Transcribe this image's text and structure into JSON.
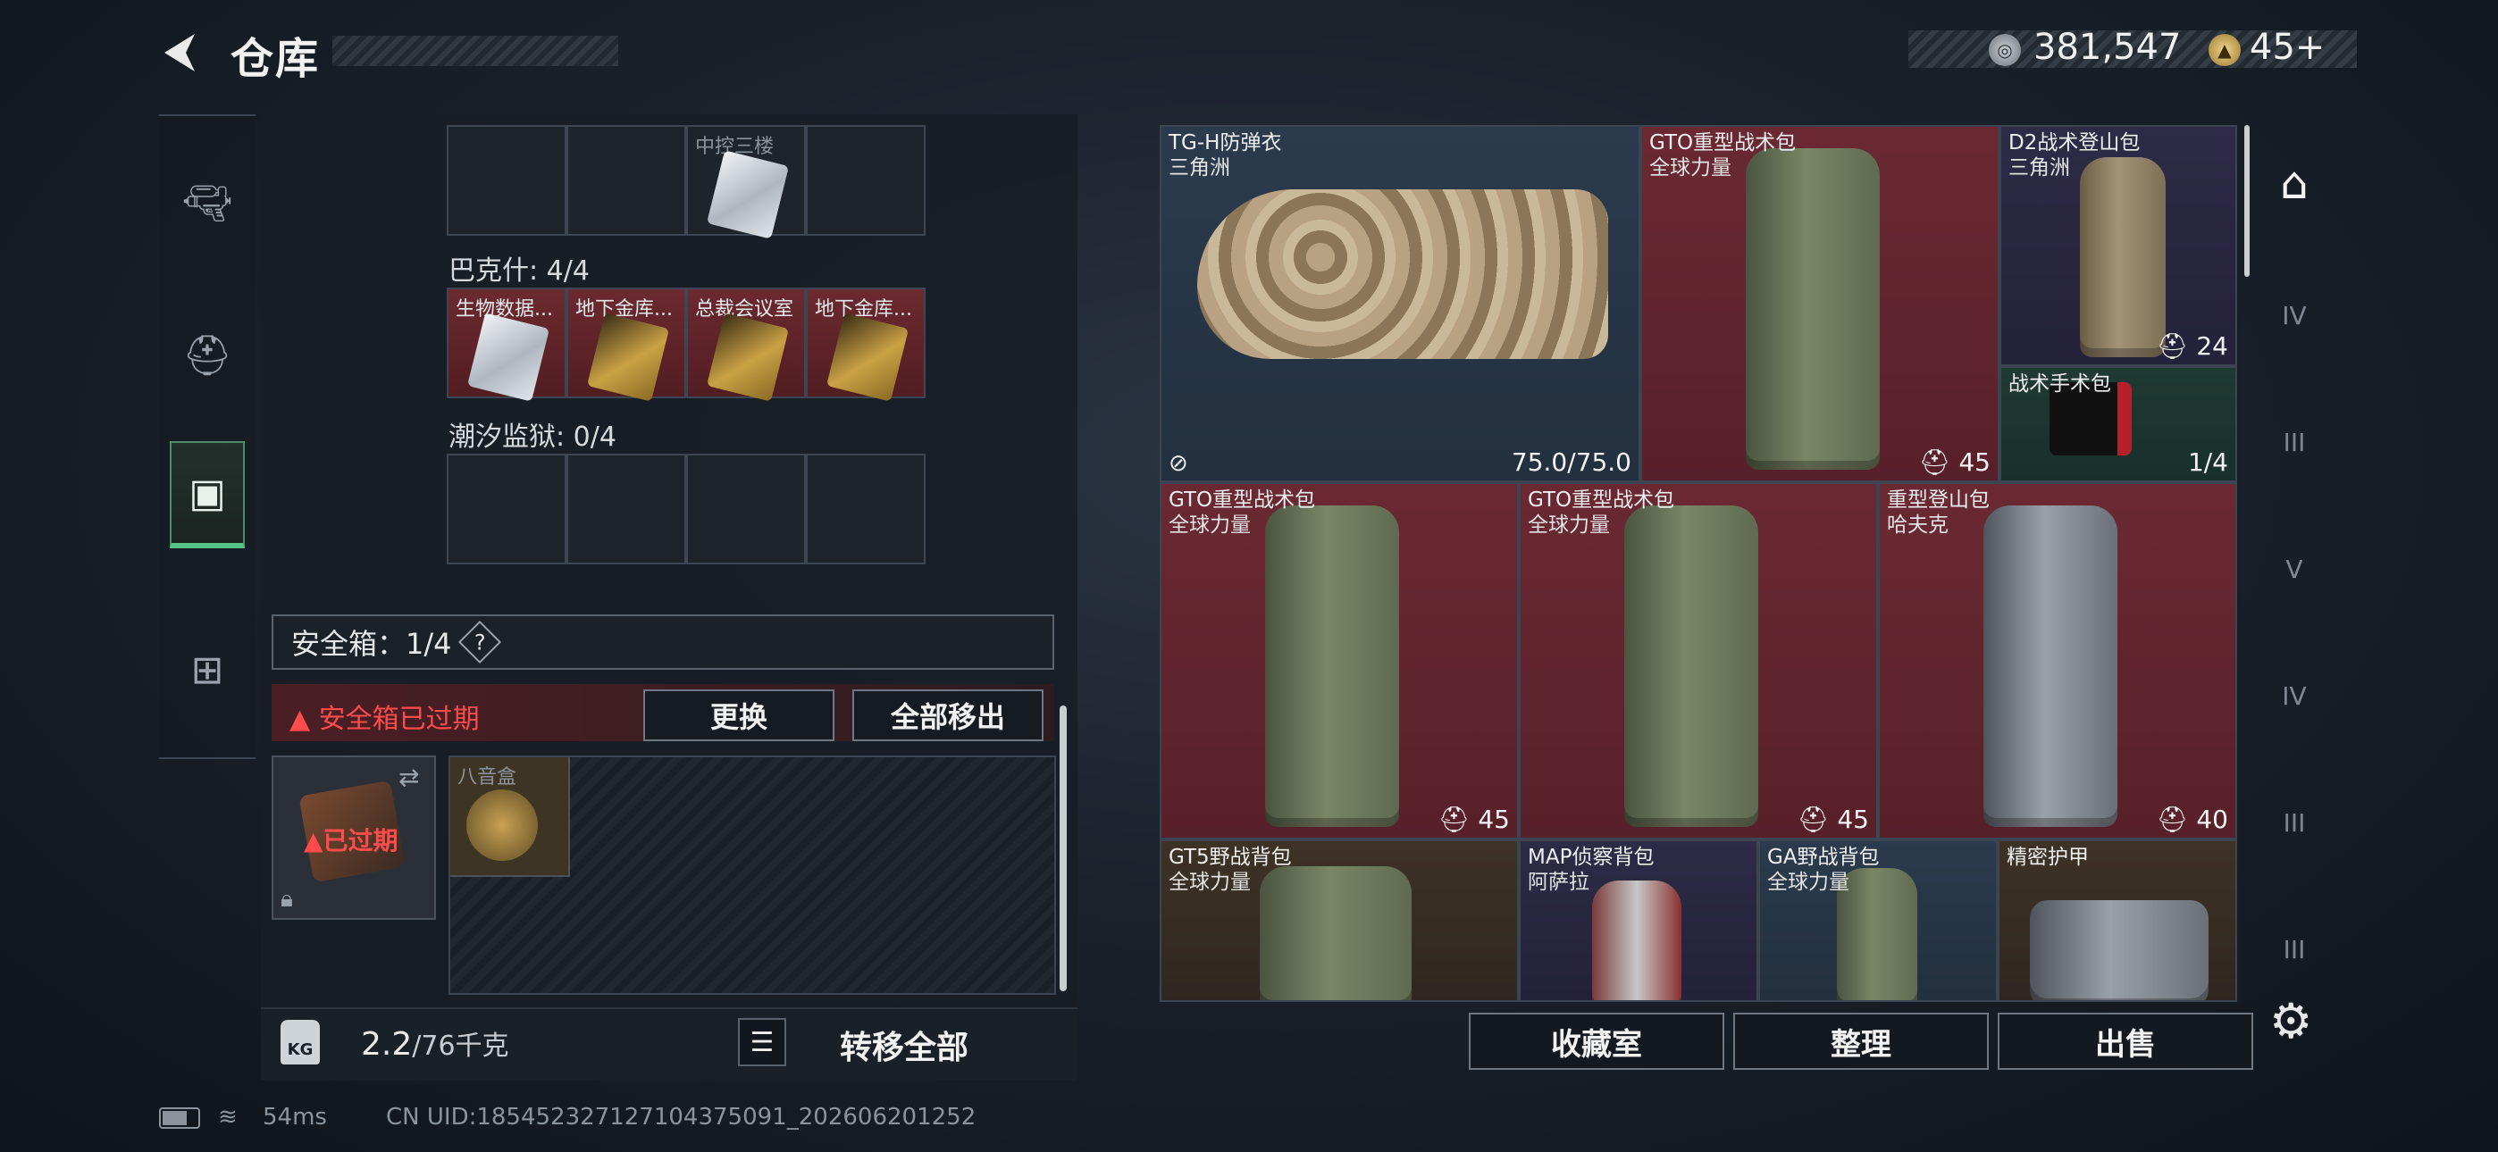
{
  "header": {
    "title": "仓库",
    "money": "381,547",
    "tokens": "45+"
  },
  "left": {
    "top_cell_label": "中控三楼",
    "sections": [
      {
        "label": "巴克什: 4/4",
        "cells": [
          "生物数据...",
          "地下金库...",
          "总裁会议室",
          "地下金库..."
        ]
      },
      {
        "label": "潮汐监狱: 0/4",
        "cells": [
          "",
          "",
          "",
          ""
        ]
      }
    ],
    "safebox_label": "安全箱：1/4",
    "safebox_help": "?",
    "expired_warning": "安全箱已过期",
    "btn_replace": "更换",
    "btn_move_all": "全部移出",
    "case_expired": "已过期",
    "container_item": "八音盒",
    "weight_value": "2.2",
    "weight_cap": "/76千克",
    "kg_label": "KG",
    "transfer_all": "转移全部"
  },
  "items": [
    {
      "name": "TG-H防弹衣",
      "sub": "三角洲",
      "count": "75.0/75.0",
      "bg": "blue"
    },
    {
      "name": "GTO重型战术包",
      "sub": "全球力量",
      "count": "45",
      "bg": "red"
    },
    {
      "name": "D2战术登山包",
      "sub": "三角洲",
      "count": "24",
      "bg": "purple"
    },
    {
      "name": "战术手术包",
      "sub": "",
      "count": "1/4",
      "bg": "green"
    },
    {
      "name": "GTO重型战术包",
      "sub": "全球力量",
      "count": "45",
      "bg": "red"
    },
    {
      "name": "GTO重型战术包",
      "sub": "全球力量",
      "count": "45",
      "bg": "red"
    },
    {
      "name": "重型登山包",
      "sub": "哈夫克",
      "count": "40",
      "bg": "red"
    },
    {
      "name": "GT5野战背包",
      "sub": "全球力量",
      "count": "",
      "bg": "brown"
    },
    {
      "name": "MAP侦察背包",
      "sub": "阿萨拉",
      "count": "",
      "bg": "purple"
    },
    {
      "name": "GA野战背包",
      "sub": "全球力量",
      "count": "",
      "bg": "blue"
    },
    {
      "name": "精密护甲",
      "sub": "",
      "count": "",
      "bg": "brown"
    }
  ],
  "sidenav": [
    "IV",
    "III",
    "V",
    "IV",
    "III",
    "III"
  ],
  "bottom": {
    "collection": "收藏室",
    "sort": "整理",
    "sell": "出售"
  },
  "status": {
    "ping": "54ms",
    "uid": "CN UID:18545232712710437509‌1_202606201252"
  },
  "colors": {
    "accent_green": "#55c489",
    "warning_red": "#ff4b4b"
  }
}
